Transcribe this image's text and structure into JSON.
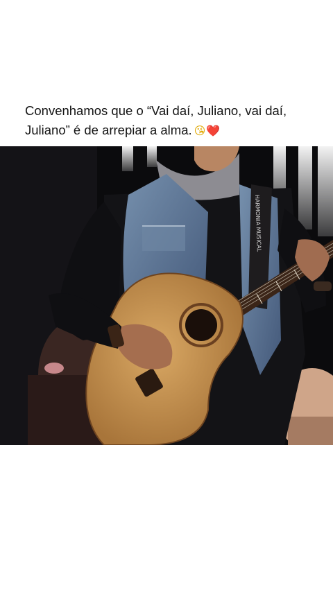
{
  "post": {
    "caption_line1": "Convenhamos que o “Vai daí, Juliano, vai daí,",
    "caption_line2": "Juliano” é de arrepiar a alma.",
    "emojis": [
      "😘",
      "❤️"
    ],
    "strap_text": "HARMONIA MUSICAL"
  },
  "colors": {
    "background": "#ffffff",
    "text": "#141414",
    "photo_bg": "#0b0b0d",
    "guitar": "#c7934e",
    "denim": "#5e7896"
  },
  "icons": {
    "emoji_1": "winking-kiss-emoji-icon",
    "emoji_2": "red-heart-emoji-icon"
  }
}
